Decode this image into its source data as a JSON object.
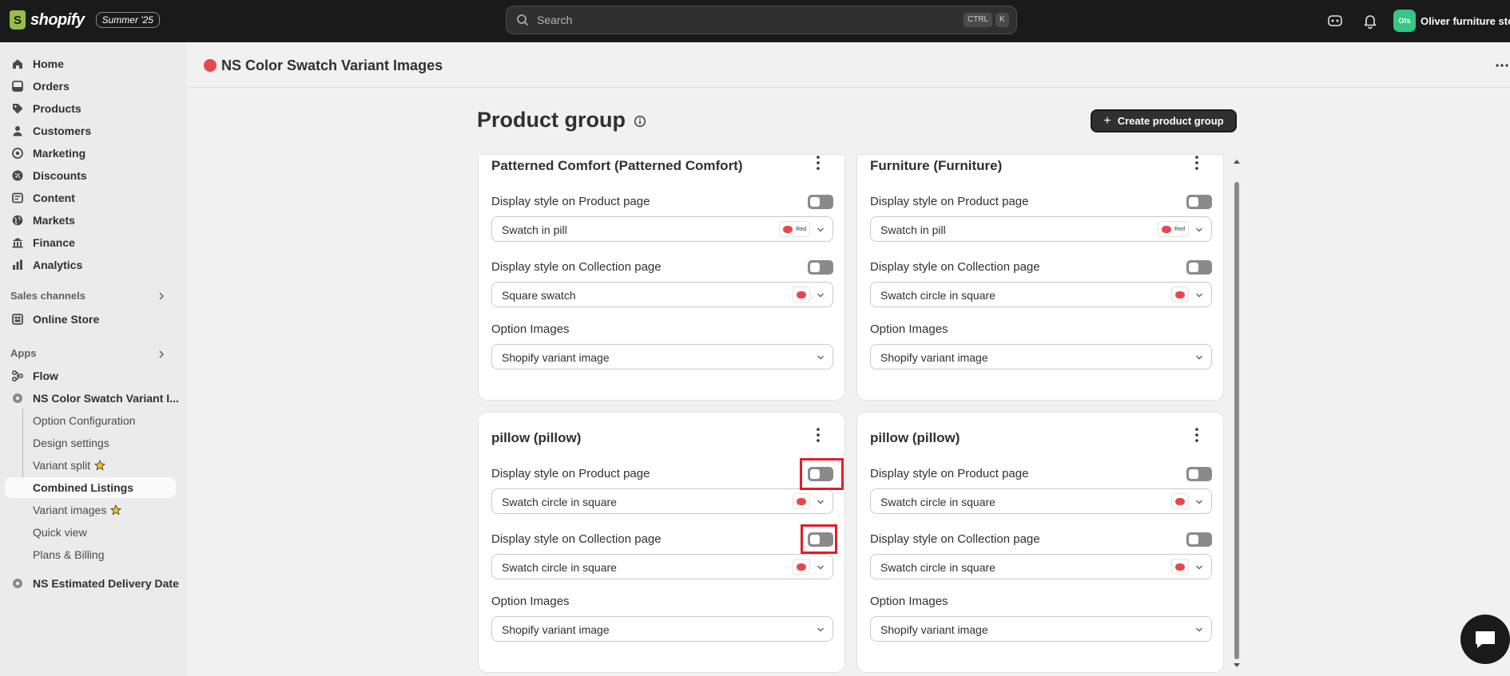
{
  "topbar": {
    "logo_text": "shopify",
    "logo_letter": "S",
    "badge": "Summer '25",
    "search_placeholder": "Search",
    "kbd_ctrl": "CTRL",
    "kbd_k": "K",
    "store_initials": "Ofs",
    "store_name": "Oliver furniture stor"
  },
  "sidebar": {
    "main_items": [
      {
        "label": "Home",
        "icon": "home-icon"
      },
      {
        "label": "Orders",
        "icon": "orders-icon"
      },
      {
        "label": "Products",
        "icon": "tag-icon"
      },
      {
        "label": "Customers",
        "icon": "person-icon"
      },
      {
        "label": "Marketing",
        "icon": "target-icon"
      },
      {
        "label": "Discounts",
        "icon": "discount-icon"
      },
      {
        "label": "Content",
        "icon": "content-icon"
      },
      {
        "label": "Markets",
        "icon": "globe-icon"
      },
      {
        "label": "Finance",
        "icon": "bank-icon"
      },
      {
        "label": "Analytics",
        "icon": "chart-icon"
      }
    ],
    "sales_channels_label": "Sales channels",
    "online_store": "Online Store",
    "apps_label": "Apps",
    "flow": "Flow",
    "app_name": "NS Color Swatch Variant I...",
    "sub_items": [
      {
        "label": "Option Configuration"
      },
      {
        "label": "Design settings"
      },
      {
        "label": "Variant split"
      },
      {
        "label": "Combined Listings"
      },
      {
        "label": "Variant images"
      },
      {
        "label": "Quick view"
      },
      {
        "label": "Plans & Billing"
      }
    ],
    "other_app": "NS Estimated Delivery Date"
  },
  "header": {
    "app_title": "NS Color Swatch Variant Images"
  },
  "page": {
    "title": "Product group",
    "create_button": "Create product group",
    "create_plus": "+"
  },
  "labels": {
    "product_page": "Display style on Product page",
    "collection_page": "Display style on Collection page",
    "option_images": "Option Images",
    "swatch_text": "Red"
  },
  "cards": [
    {
      "title": "Patterned Comfort (Patterned Comfort)",
      "product_style": "Swatch in pill",
      "collection_style": "Square swatch",
      "option_image": "Shopify variant image"
    },
    {
      "title": "Furniture (Furniture)",
      "product_style": "Swatch in pill",
      "collection_style": "Swatch circle in square",
      "option_image": "Shopify variant image"
    },
    {
      "title": "pillow (pillow)",
      "product_style": "Swatch circle in square",
      "collection_style": "Swatch circle in square",
      "option_image": "Shopify variant image"
    },
    {
      "title": "pillow (pillow)",
      "product_style": "Swatch circle in square",
      "collection_style": "Swatch circle in square",
      "option_image": "Shopify variant image"
    }
  ],
  "colors": {
    "accent_red": "#e5484d",
    "highlight": "#e11d2a",
    "topbar": "#1a1a1a"
  }
}
